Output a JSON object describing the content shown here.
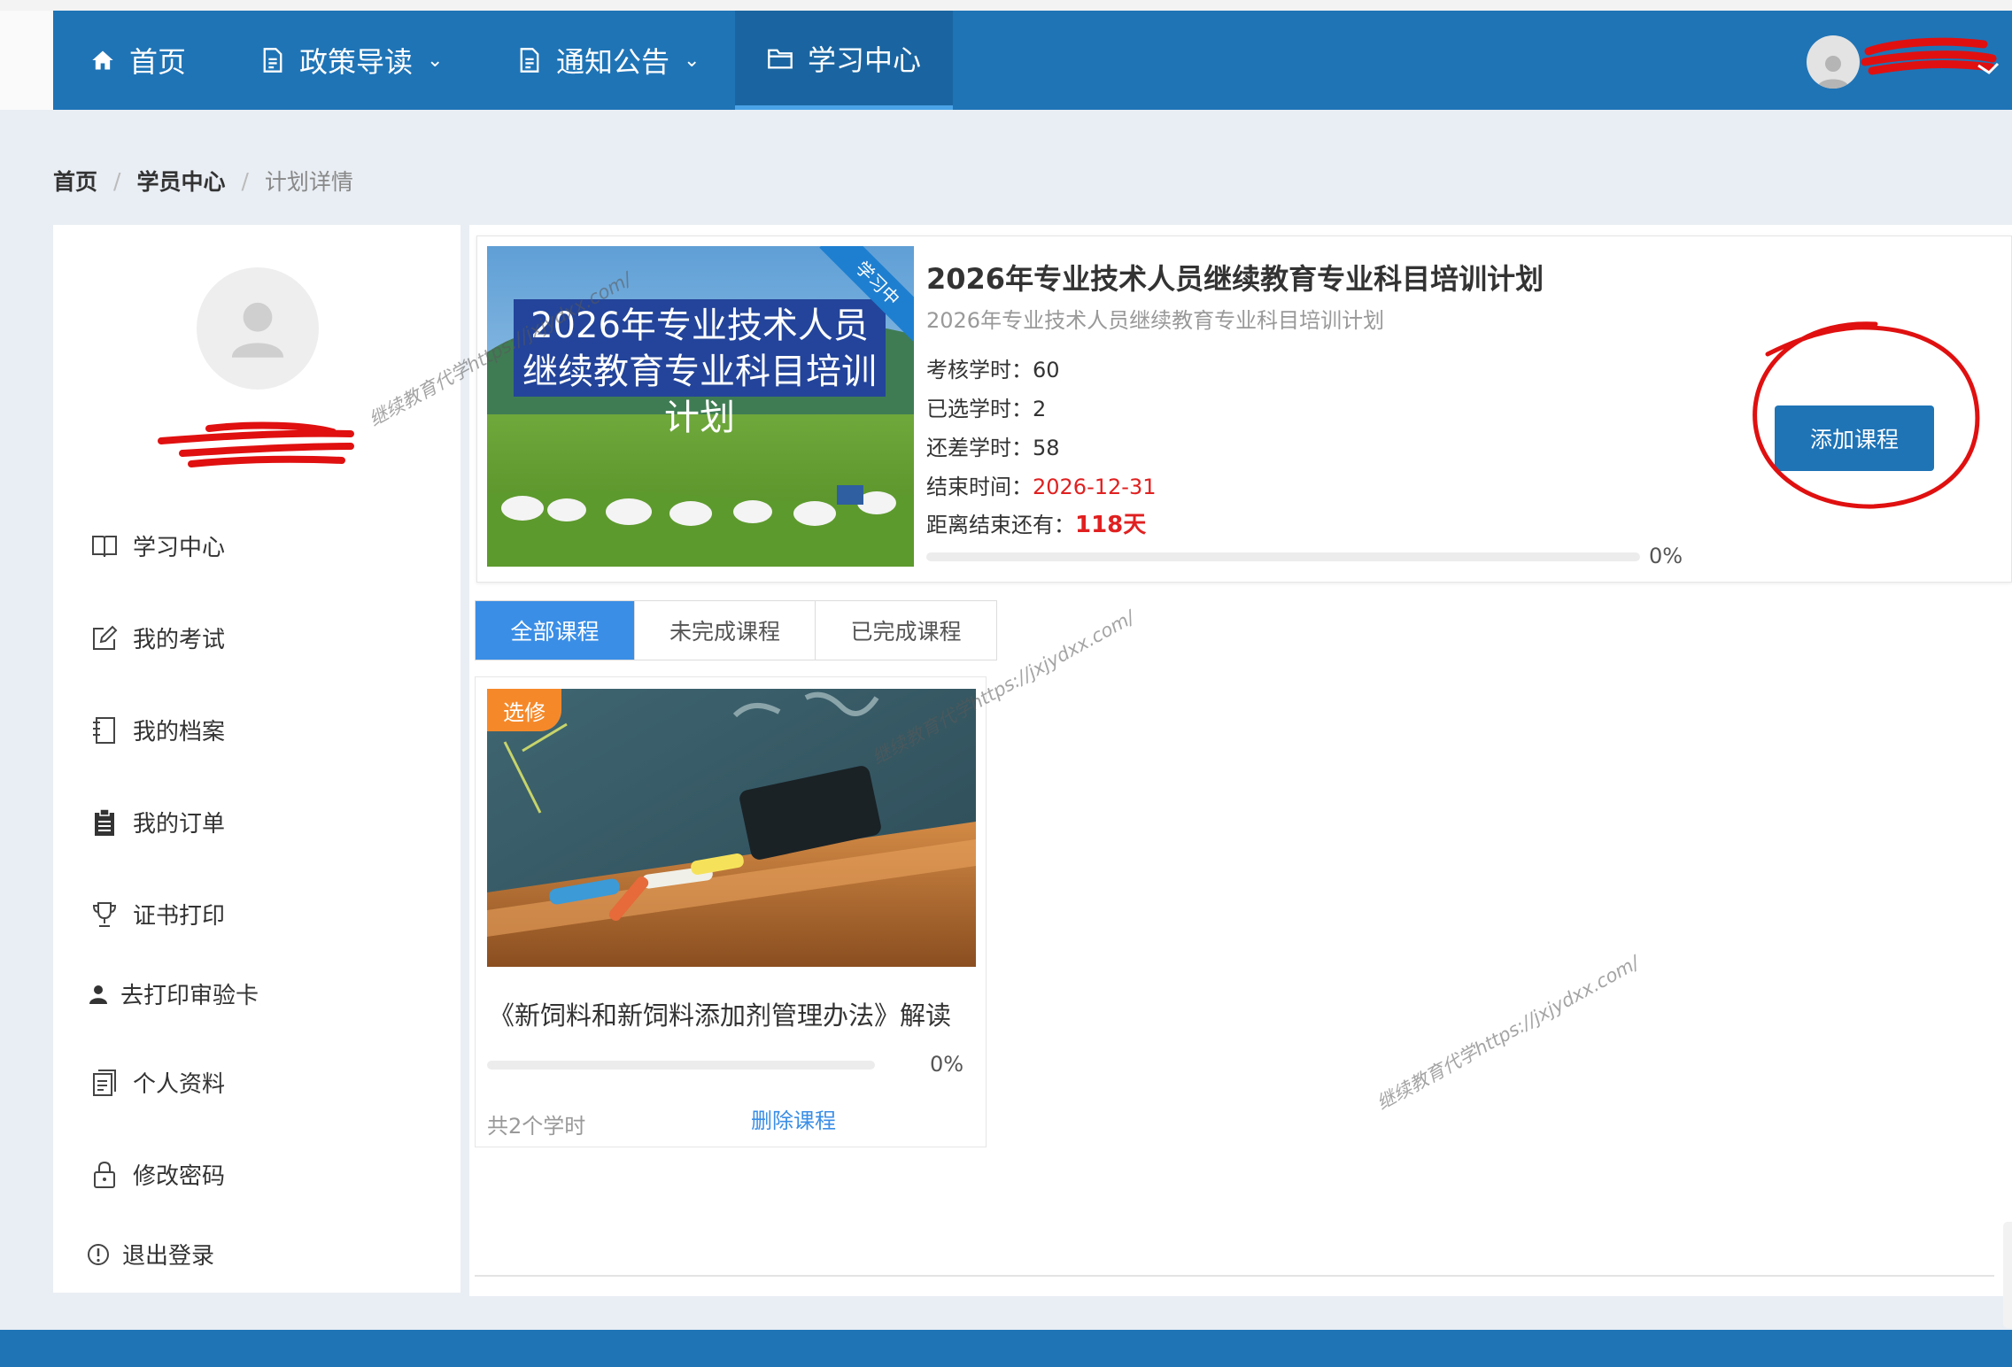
{
  "nav": {
    "items": [
      {
        "label": "首页",
        "icon": "home-icon"
      },
      {
        "label": "政策导读",
        "icon": "document-icon",
        "has_dropdown": true
      },
      {
        "label": "通知公告",
        "icon": "document-icon",
        "has_dropdown": true
      },
      {
        "label": "学习中心",
        "icon": "folder-icon",
        "active": true
      }
    ],
    "chevron": "⌄"
  },
  "breadcrumb": {
    "items": [
      "首页",
      "学员中心",
      "计划详情"
    ],
    "separator": "/"
  },
  "sidebar": {
    "menu": [
      {
        "label": "学习中心",
        "icon": "book-icon"
      },
      {
        "label": "我的考试",
        "icon": "edit-icon"
      },
      {
        "label": "我的档案",
        "icon": "notebook-icon"
      },
      {
        "label": "我的订单",
        "icon": "clipboard-icon"
      },
      {
        "label": "证书打印",
        "icon": "trophy-icon"
      },
      {
        "label": "去打印审验卡",
        "icon": "user-icon"
      },
      {
        "label": "个人资料",
        "icon": "profile-icon"
      },
      {
        "label": "修改密码",
        "icon": "lock-icon"
      },
      {
        "label": "退出登录",
        "icon": "info-icon"
      }
    ]
  },
  "plan": {
    "image_title_line1": "2026年专业技术人员",
    "image_title_line2": "继续教育专业科目培训计划",
    "ribbon": "学习中",
    "title": "2026年专业技术人员继续教育专业科目培训计划",
    "subtitle": "2026年专业技术人员继续教育专业科目培训计划",
    "required_hours_label": "考核学时：",
    "required_hours": "60",
    "selected_hours_label": "已选学时：",
    "selected_hours": "2",
    "remaining_hours_label": "还差学时：",
    "remaining_hours": "58",
    "end_time_label": "结束时间：",
    "end_time": "2026-12-31",
    "days_left_label": "距离结束还有：",
    "days_left": "118天",
    "progress_text": "0%",
    "progress": 0,
    "add_button": "添加课程"
  },
  "tabs": [
    {
      "label": "全部课程",
      "active": true
    },
    {
      "label": "未完成课程",
      "active": false
    },
    {
      "label": "已完成课程",
      "active": false
    }
  ],
  "course": {
    "badge": "选修",
    "title": "《新饲料和新饲料添加剂管理办法》解读",
    "progress_text": "0%",
    "progress": 0,
    "hours": "共2个学时",
    "delete_link": "删除课程"
  },
  "watermark": "继续教育代学https://jxjydxx.com/",
  "colors": {
    "nav_bg": "#1f74b6",
    "accent": "#3a8ee6",
    "danger": "#e02020",
    "badge": "#f5892a",
    "annotation": "#e01010"
  }
}
